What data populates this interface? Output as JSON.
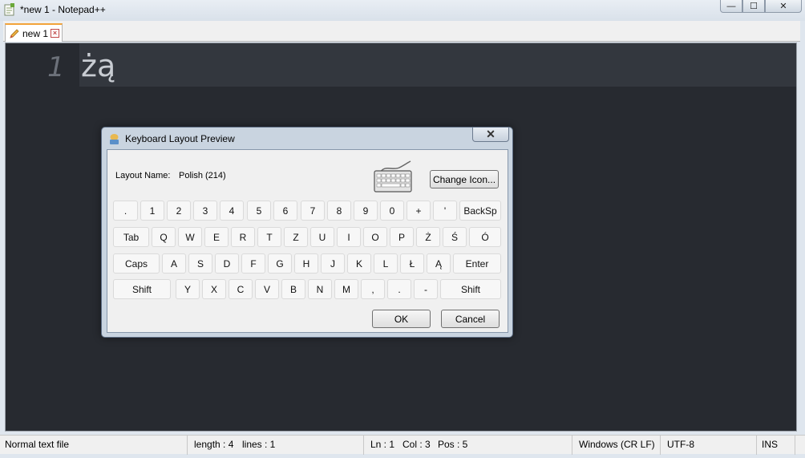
{
  "window": {
    "title": "*new 1 - Notepad++",
    "controls": {
      "minimize": "—",
      "maximize": "☐",
      "close": "✕"
    }
  },
  "tabs": [
    {
      "label": "new 1",
      "icon": "pencil-icon",
      "close_icon": "close-tab-icon"
    }
  ],
  "editor": {
    "line_number": "1",
    "line_text": "żą",
    "colors": {
      "background": "#272a30",
      "current_line": "#33373e",
      "text": "#c8ccd2"
    }
  },
  "dialog": {
    "title": "Keyboard Layout Preview",
    "close": "✕",
    "layout_label": "Layout Name:",
    "layout_value": "Polish (214)",
    "change_icon_label": "Change Icon...",
    "ok_label": "OK",
    "cancel_label": "Cancel",
    "rows": [
      [
        ".",
        "1",
        "2",
        "3",
        "4",
        "5",
        "6",
        "7",
        "8",
        "9",
        "0",
        "+",
        "'",
        "BackSp"
      ],
      [
        "Tab",
        "Q",
        "W",
        "E",
        "R",
        "T",
        "Z",
        "U",
        "I",
        "O",
        "P",
        "Ż",
        "Ś",
        "Ó"
      ],
      [
        "Caps",
        "A",
        "S",
        "D",
        "F",
        "G",
        "H",
        "J",
        "K",
        "L",
        "Ł",
        "Ą",
        "Enter"
      ],
      [
        "Shift",
        "Y",
        "X",
        "C",
        "V",
        "B",
        "N",
        "M",
        ",",
        ".",
        "-",
        "Shift"
      ]
    ]
  },
  "status": {
    "filetype": "Normal text file",
    "length": "length : 4",
    "lines": "lines : 1",
    "ln": "Ln : 1",
    "col": "Col : 3",
    "pos": "Pos : 5",
    "eol": "Windows (CR LF)",
    "encoding": "UTF-8",
    "mode": "INS"
  }
}
